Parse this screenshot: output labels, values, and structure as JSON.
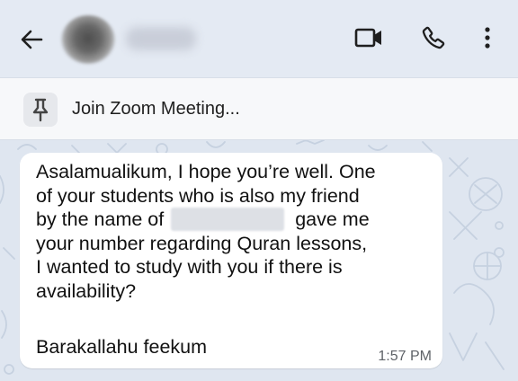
{
  "pinned": {
    "text": "Join Zoom Meeting..."
  },
  "message": {
    "line1": "Asalamualikum, I hope you’re well. One",
    "line2": "of your students who is also my friend",
    "line3a": "by the name of",
    "line3b": "gave me",
    "line4": "your number regarding Quran lessons,",
    "line5": "I wanted to study with you if there is",
    "line6": "availability?",
    "signoff": "Barakallahu feekum",
    "time": "1:57 PM"
  },
  "colors": {
    "header_bg": "#e4eaf3",
    "chat_bg": "#dfe6f0",
    "bubble_bg": "#ffffff",
    "icon_color": "#1f1f1f"
  },
  "icons": {
    "back": "arrow-left",
    "video": "video-camera",
    "call": "phone",
    "menu": "more-vertical",
    "pin": "push-pin"
  }
}
